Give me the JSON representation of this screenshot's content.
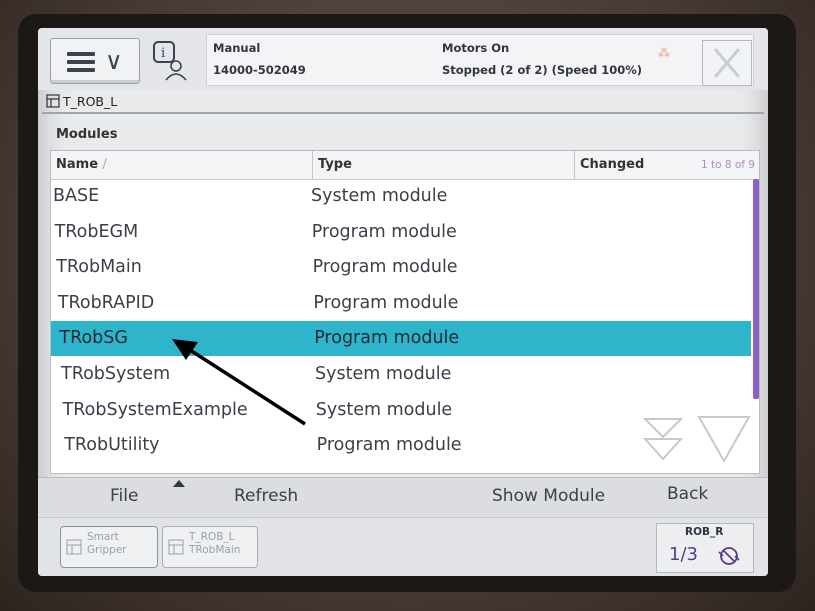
{
  "header": {
    "mode": "Manual",
    "controller_id": "14000-502049",
    "motors_state": "Motors On",
    "run_state": "Stopped (2 of 2) (Speed 100%)"
  },
  "task": {
    "label": "T_ROB_L"
  },
  "section": {
    "title": "Modules"
  },
  "table": {
    "columns": [
      "Name",
      "Type",
      "Changed"
    ],
    "sort_indicator": "/",
    "pager": "1 to 8 of 9",
    "rows": [
      {
        "name": "BASE",
        "type": "System module",
        "changed": ""
      },
      {
        "name": "TRobEGM",
        "type": "Program module",
        "changed": ""
      },
      {
        "name": "TRobMain",
        "type": "Program module",
        "changed": ""
      },
      {
        "name": "TRobRAPID",
        "type": "Program module",
        "changed": ""
      },
      {
        "name": "TRobSG",
        "type": "Program module",
        "changed": "",
        "selected": true
      },
      {
        "name": "TRobSystem",
        "type": "System module",
        "changed": ""
      },
      {
        "name": "TRobSystemExample",
        "type": "System module",
        "changed": ""
      },
      {
        "name": "TRobUtility",
        "type": "Program module",
        "changed": ""
      }
    ]
  },
  "commands": {
    "file": "File",
    "refresh": "Refresh",
    "show_module": "Show Module",
    "back": "Back"
  },
  "taskbar": {
    "smart_gripper_line1": "Smart",
    "smart_gripper_line2": "Gripper",
    "trob_line1": "T_ROB_L",
    "trob_line2": "TRobMain",
    "robot": "ROB_R",
    "fraction": "1/3"
  },
  "colors": {
    "selection": "#2fb5cb",
    "scrollbar": "#8c62c8",
    "annotation_arrow": "#000000"
  }
}
